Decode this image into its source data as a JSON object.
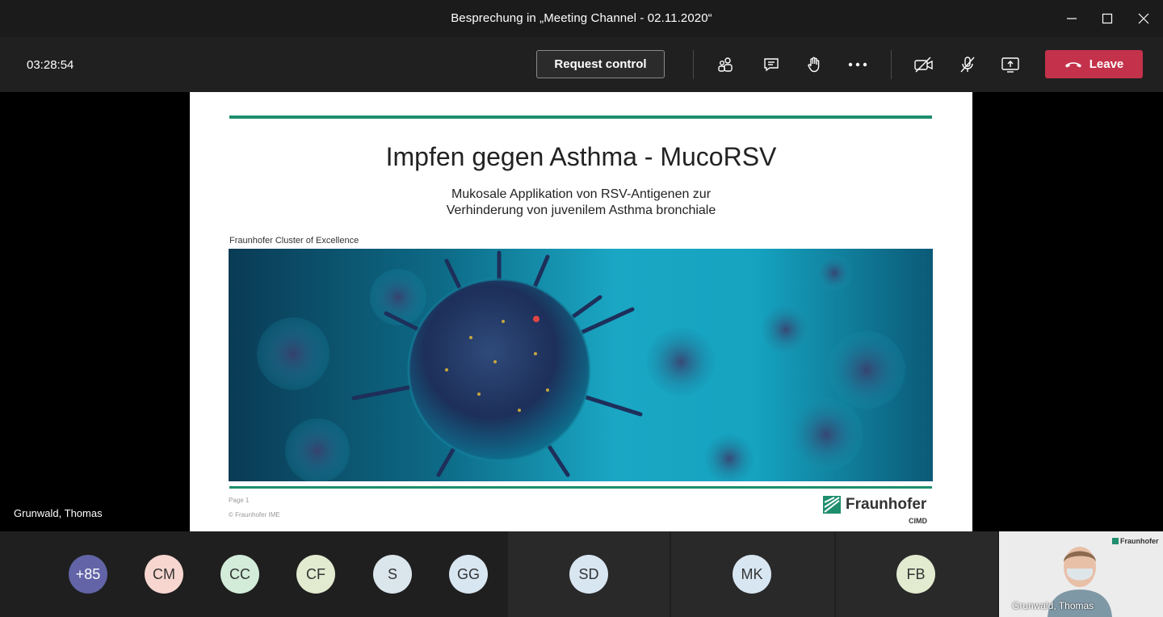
{
  "window": {
    "title": "Besprechung in „Meeting Channel - 02.11.2020“",
    "controls": [
      "minimize-icon",
      "maximize-icon",
      "close-icon"
    ]
  },
  "toolbar": {
    "timer": "03:28:54",
    "request_control_label": "Request control",
    "icons": [
      "participants-icon",
      "chat-icon",
      "raise-hand-icon",
      "more-icon",
      "camera-off-icon",
      "mic-off-icon",
      "share-screen-icon"
    ],
    "leave_label": "Leave",
    "leave_color": "#c4314b"
  },
  "slide": {
    "title": "Impfen gegen Asthma - MucoRSV",
    "subtitle_line1": "Mukosale Applikation von RSV-Antigenen zur",
    "subtitle_line2": "Verhinderung von juvenilem Asthma bronchiale",
    "label": "Fraunhofer Cluster of Excellence",
    "page": "Page 1",
    "copyright": "© Fraunhofer IME",
    "logo_text": "Fraunhofer",
    "logo_sub": "CIMD",
    "accent_color": "#1e8e6e"
  },
  "presenter": {
    "name": "Grunwald, Thomas"
  },
  "participants": [
    {
      "initials": "+85",
      "color": "#6264a7"
    },
    {
      "initials": "CM",
      "color": "#f6d6cf"
    },
    {
      "initials": "CC",
      "color": "#d2ecd9"
    },
    {
      "initials": "CF",
      "color": "#e2ead0"
    },
    {
      "initials": "S",
      "color": "#dbe5ec"
    },
    {
      "initials": "GG",
      "color": "#d8e6f2"
    },
    {
      "initials": "SD",
      "color": "#d8e6f2"
    },
    {
      "initials": "MK",
      "color": "#d8e6f2"
    },
    {
      "initials": "FB",
      "color": "#e2ead0"
    }
  ],
  "video": {
    "name": "Grunwald, Thomas",
    "logo_text": "Fraunhofer"
  }
}
